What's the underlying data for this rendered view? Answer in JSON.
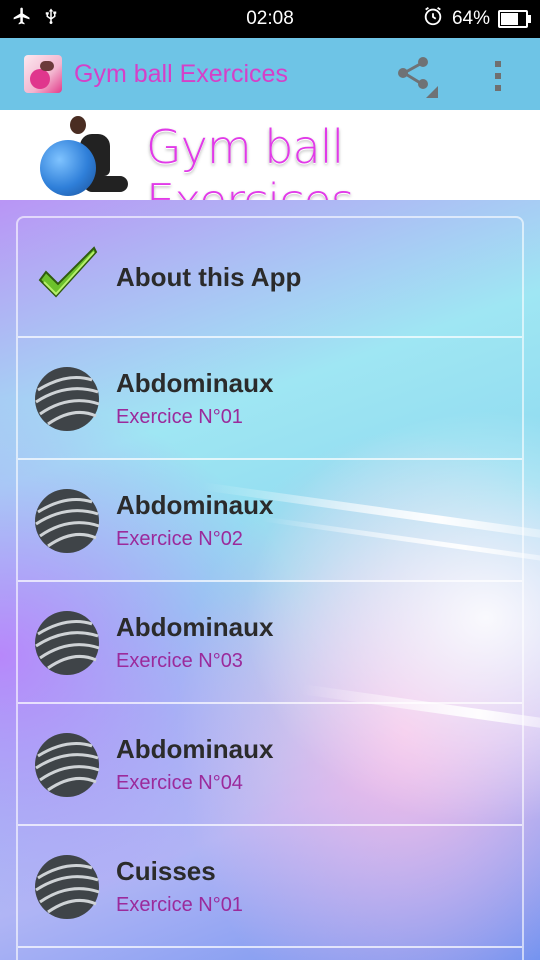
{
  "status_bar": {
    "time": "02:08",
    "battery": "64%",
    "battery_level": 0.64,
    "left_icons": [
      "airplane-icon",
      "usb-icon"
    ],
    "right_icons": [
      "alarm-icon",
      "battery-icon"
    ]
  },
  "app_bar": {
    "title": "Gym ball Exercices",
    "title_color": "#d540c8",
    "background": "#6ec4e6",
    "actions": [
      "share-icon",
      "more-vert-icon"
    ]
  },
  "banner": {
    "title": "Gym ball Exercices",
    "title_color": "#e13ae8"
  },
  "list": {
    "about": {
      "title": "About this App",
      "icon": "checkmark-icon"
    },
    "items": [
      {
        "title": "Abdominaux",
        "subtitle": "Exercice N°01",
        "icon": "gym-ball-icon"
      },
      {
        "title": "Abdominaux",
        "subtitle": "Exercice N°02",
        "icon": "gym-ball-icon"
      },
      {
        "title": "Abdominaux",
        "subtitle": "Exercice N°03",
        "icon": "gym-ball-icon"
      },
      {
        "title": "Abdominaux",
        "subtitle": "Exercice N°04",
        "icon": "gym-ball-icon"
      },
      {
        "title": "Cuisses",
        "subtitle": "Exercice N°01",
        "icon": "gym-ball-icon"
      }
    ]
  }
}
